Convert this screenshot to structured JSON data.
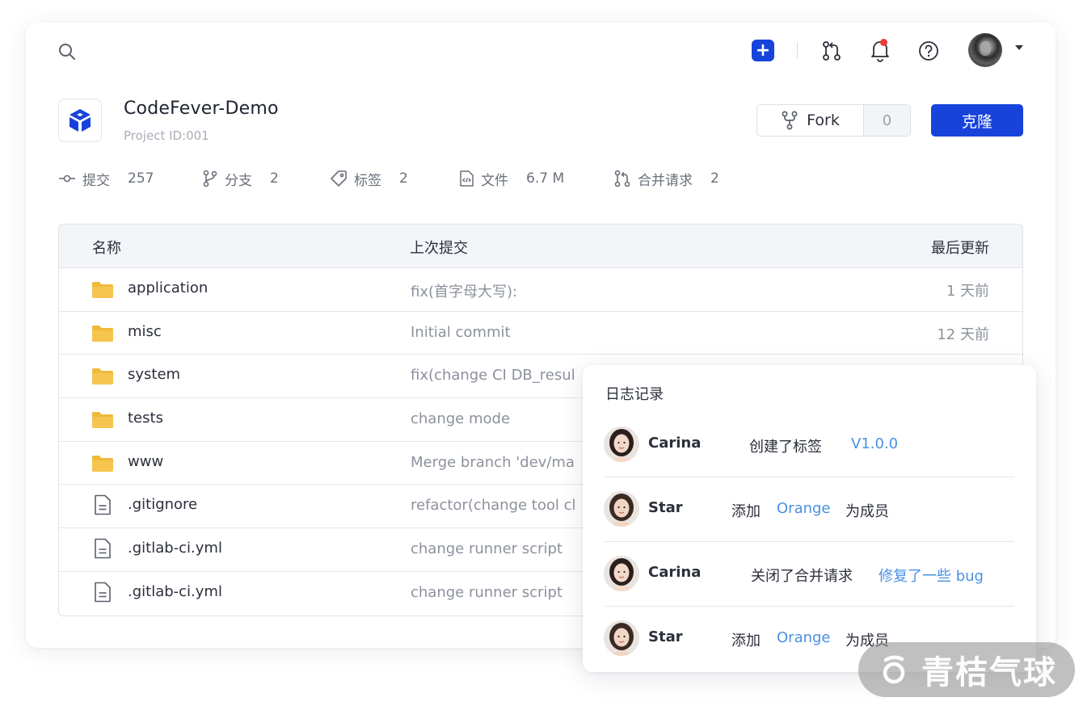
{
  "header": {
    "add_label": "+"
  },
  "project": {
    "title": "CodeFever-Demo",
    "id_text": "Project ID:001"
  },
  "actions": {
    "fork_label": "Fork",
    "fork_count": "0",
    "clone_label": "克隆"
  },
  "stats": [
    {
      "label": "提交",
      "value": "257",
      "icon": "commit-icon"
    },
    {
      "label": "分支",
      "value": "2",
      "icon": "branch-icon"
    },
    {
      "label": "标签",
      "value": "2",
      "icon": "tag-icon"
    },
    {
      "label": "文件",
      "value": "6.7 M",
      "icon": "file-code-icon"
    },
    {
      "label": "合并请求",
      "value": "2",
      "icon": "merge-request-icon"
    }
  ],
  "table": {
    "columns": {
      "name": "名称",
      "last_commit": "上次提交",
      "updated": "最后更新"
    },
    "rows": [
      {
        "type": "folder",
        "name": "application",
        "commit": "fix(首字母大写):",
        "time": "1 天前"
      },
      {
        "type": "folder",
        "name": "misc",
        "commit": "Initial commit",
        "time": "12 天前"
      },
      {
        "type": "folder",
        "name": "system",
        "commit": "fix(change CI DB_resul",
        "time": ""
      },
      {
        "type": "folder",
        "name": "tests",
        "commit": "change mode",
        "time": ""
      },
      {
        "type": "folder",
        "name": "www",
        "commit": "Merge branch 'dev/ma",
        "time": ""
      },
      {
        "type": "file",
        "name": ".gitignore",
        "commit": "refactor(change tool cl",
        "time": ""
      },
      {
        "type": "file",
        "name": ".gitlab-ci.yml",
        "commit": "change runner script",
        "time": ""
      },
      {
        "type": "file",
        "name": ".gitlab-ci.yml",
        "commit": "change runner script",
        "time": ""
      }
    ]
  },
  "log": {
    "title": "日志记录",
    "items": [
      {
        "user": "Carina",
        "action": "创建了标签",
        "link": "V1.0.0",
        "tail": ""
      },
      {
        "user": "Star",
        "action": "添加",
        "link": "Orange",
        "tail": "为成员"
      },
      {
        "user": "Carina",
        "action": "关闭了合并请求",
        "link": "修复了一些 bug",
        "tail": ""
      },
      {
        "user": "Star",
        "action": "添加",
        "link": "Orange",
        "tail": "为成员"
      }
    ]
  },
  "watermark": {
    "text": "青桔气球"
  },
  "colors": {
    "primary": "#1843db",
    "link": "#4a90e2",
    "folder": "#f0b93a",
    "notify_dot": "#ef3b36"
  }
}
